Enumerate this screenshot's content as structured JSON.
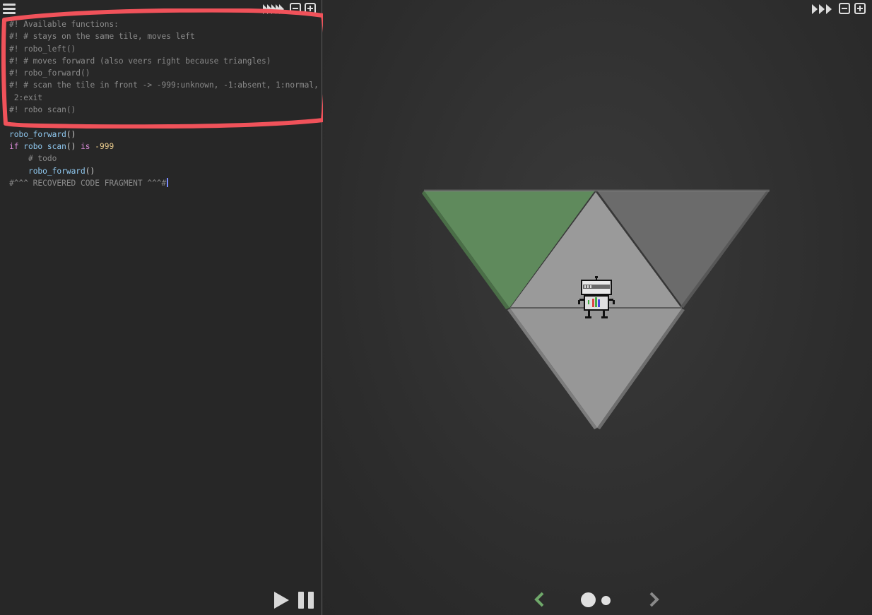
{
  "editor": {
    "lines": [
      [
        {
          "t": "#! Available functions:",
          "c": "comment"
        }
      ],
      [
        {
          "t": "#! # stays on the same tile, moves left",
          "c": "comment"
        }
      ],
      [
        {
          "t": "#! robo_left()",
          "c": "comment"
        }
      ],
      [
        {
          "t": "#! # moves forward (also veers right because triangles)",
          "c": "comment"
        }
      ],
      [
        {
          "t": "#! robo_forward()",
          "c": "comment"
        }
      ],
      [
        {
          "t": "#! # scan the tile in front -> -999:unknown, -1:absent, 1:normal,",
          "c": "comment"
        }
      ],
      [
        {
          "t": " 2:exit",
          "c": "comment"
        }
      ],
      [
        {
          "t": "#! robo scan()",
          "c": "comment"
        }
      ],
      [
        {
          "t": "",
          "c": "plain"
        }
      ],
      [
        {
          "t": "robo_forward",
          "c": "fn"
        },
        {
          "t": "()",
          "c": "plain"
        }
      ],
      [
        {
          "t": "if ",
          "c": "kw"
        },
        {
          "t": "robo scan",
          "c": "fn"
        },
        {
          "t": "() ",
          "c": "plain"
        },
        {
          "t": "is ",
          "c": "kw"
        },
        {
          "t": "-999",
          "c": "num"
        }
      ],
      [
        {
          "t": "    # todo",
          "c": "comment"
        }
      ],
      [
        {
          "t": "    ",
          "c": "plain"
        },
        {
          "t": "robo_forward",
          "c": "fn"
        },
        {
          "t": "()",
          "c": "plain"
        }
      ],
      [
        {
          "t": "#^^^ RECOVERED CODE FRAGMENT ^^^#",
          "c": "comment"
        }
      ]
    ]
  },
  "icons": {
    "menu": "hamburger-menu-icon",
    "speed": "fast-forward-icon",
    "zoom_out": "zoom-out-icon",
    "zoom_in": "zoom-in-icon",
    "play": "play-icon",
    "pause": "pause-icon",
    "prev": "chevron-left-icon",
    "next": "chevron-right-icon"
  },
  "level": {
    "total_pages": 2,
    "current_page": 1
  },
  "colors": {
    "annotation": "#f0525a",
    "tile_exit": "#5f8a5c",
    "tile_normal": "#9a9a9a",
    "tile_dark": "#6b6b6b",
    "prev_arrow": "#6fa86a"
  }
}
